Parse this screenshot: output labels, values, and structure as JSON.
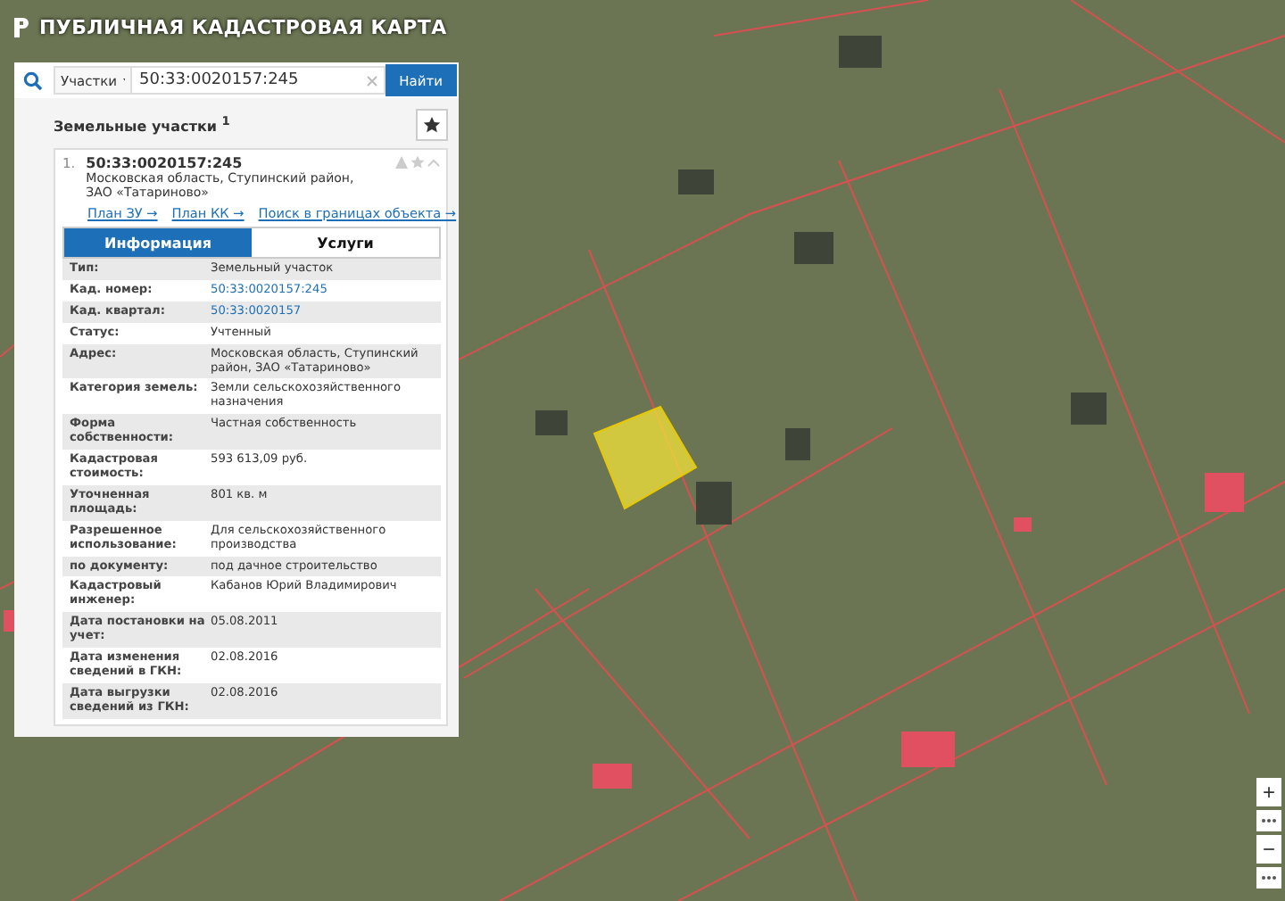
{
  "header": {
    "title": "ПУБЛИЧНАЯ КАДАСТРОВАЯ КАРТА"
  },
  "search": {
    "category": "Участки",
    "value": "50:33:0020157:245",
    "button": "Найти"
  },
  "results": {
    "title": "Земельные участки $^{1}$"
  },
  "result": {
    "index": "1.",
    "number": "50:33:0020157:245",
    "address": "Московская область, Ступинский район, ЗАО «Татариново»",
    "links": [
      "План ЗУ →",
      "План КК →",
      "Поиск в границах объекта →"
    ],
    "tabs": [
      {
        "label": "Информация",
        "selected": true
      },
      {
        "label": "Услуги",
        "selected": false
      }
    ],
    "fields": [
      {
        "label": "Тип:",
        "value": "Земельный участок",
        "kind": "text"
      },
      {
        "label": "Кад. номер:",
        "value": "50:33:0020157:245",
        "kind": "link"
      },
      {
        "label": "Кад. квартал:",
        "value": "50:33:0020157",
        "kind": "link"
      },
      {
        "label": "Статус:",
        "value": "Учтенный",
        "kind": "text"
      },
      {
        "label": "Адрес:",
        "value": "Московская область, Ступинский район, ЗАО «Татариново»",
        "kind": "text"
      },
      {
        "label": "Категория земель:",
        "value": "Земли сельскохозяйственного назначения",
        "kind": "text"
      },
      {
        "label": "Форма собственности:",
        "value": "Частная собственность",
        "kind": "text"
      },
      {
        "label": "Кадастровая стоимость:",
        "value": "593 613,09 руб.",
        "kind": "text"
      },
      {
        "label": "Уточненная площадь:",
        "value": "801 кв. м",
        "kind": "text"
      },
      {
        "label": "Разрешенное использование:",
        "value": "Для сельскохозяйственного производства",
        "kind": "text"
      },
      {
        "label": "по документу:",
        "value": "под дачное строительство",
        "kind": "text"
      },
      {
        "label": "Кадастровый инженер:",
        "value": "Кабанов Юрий Владимирович",
        "kind": "text"
      },
      {
        "label": "Дата постановки на учет:",
        "value": "05.08.2011",
        "kind": "text"
      },
      {
        "label": "Дата изменения сведений в ГКН:",
        "value": "02.08.2016",
        "kind": "text"
      },
      {
        "label": "Дата выгрузки сведений из ГКН:",
        "value": "02.08.2016",
        "kind": "text"
      }
    ]
  },
  "zoom": {
    "in": "+",
    "out": "−"
  }
}
